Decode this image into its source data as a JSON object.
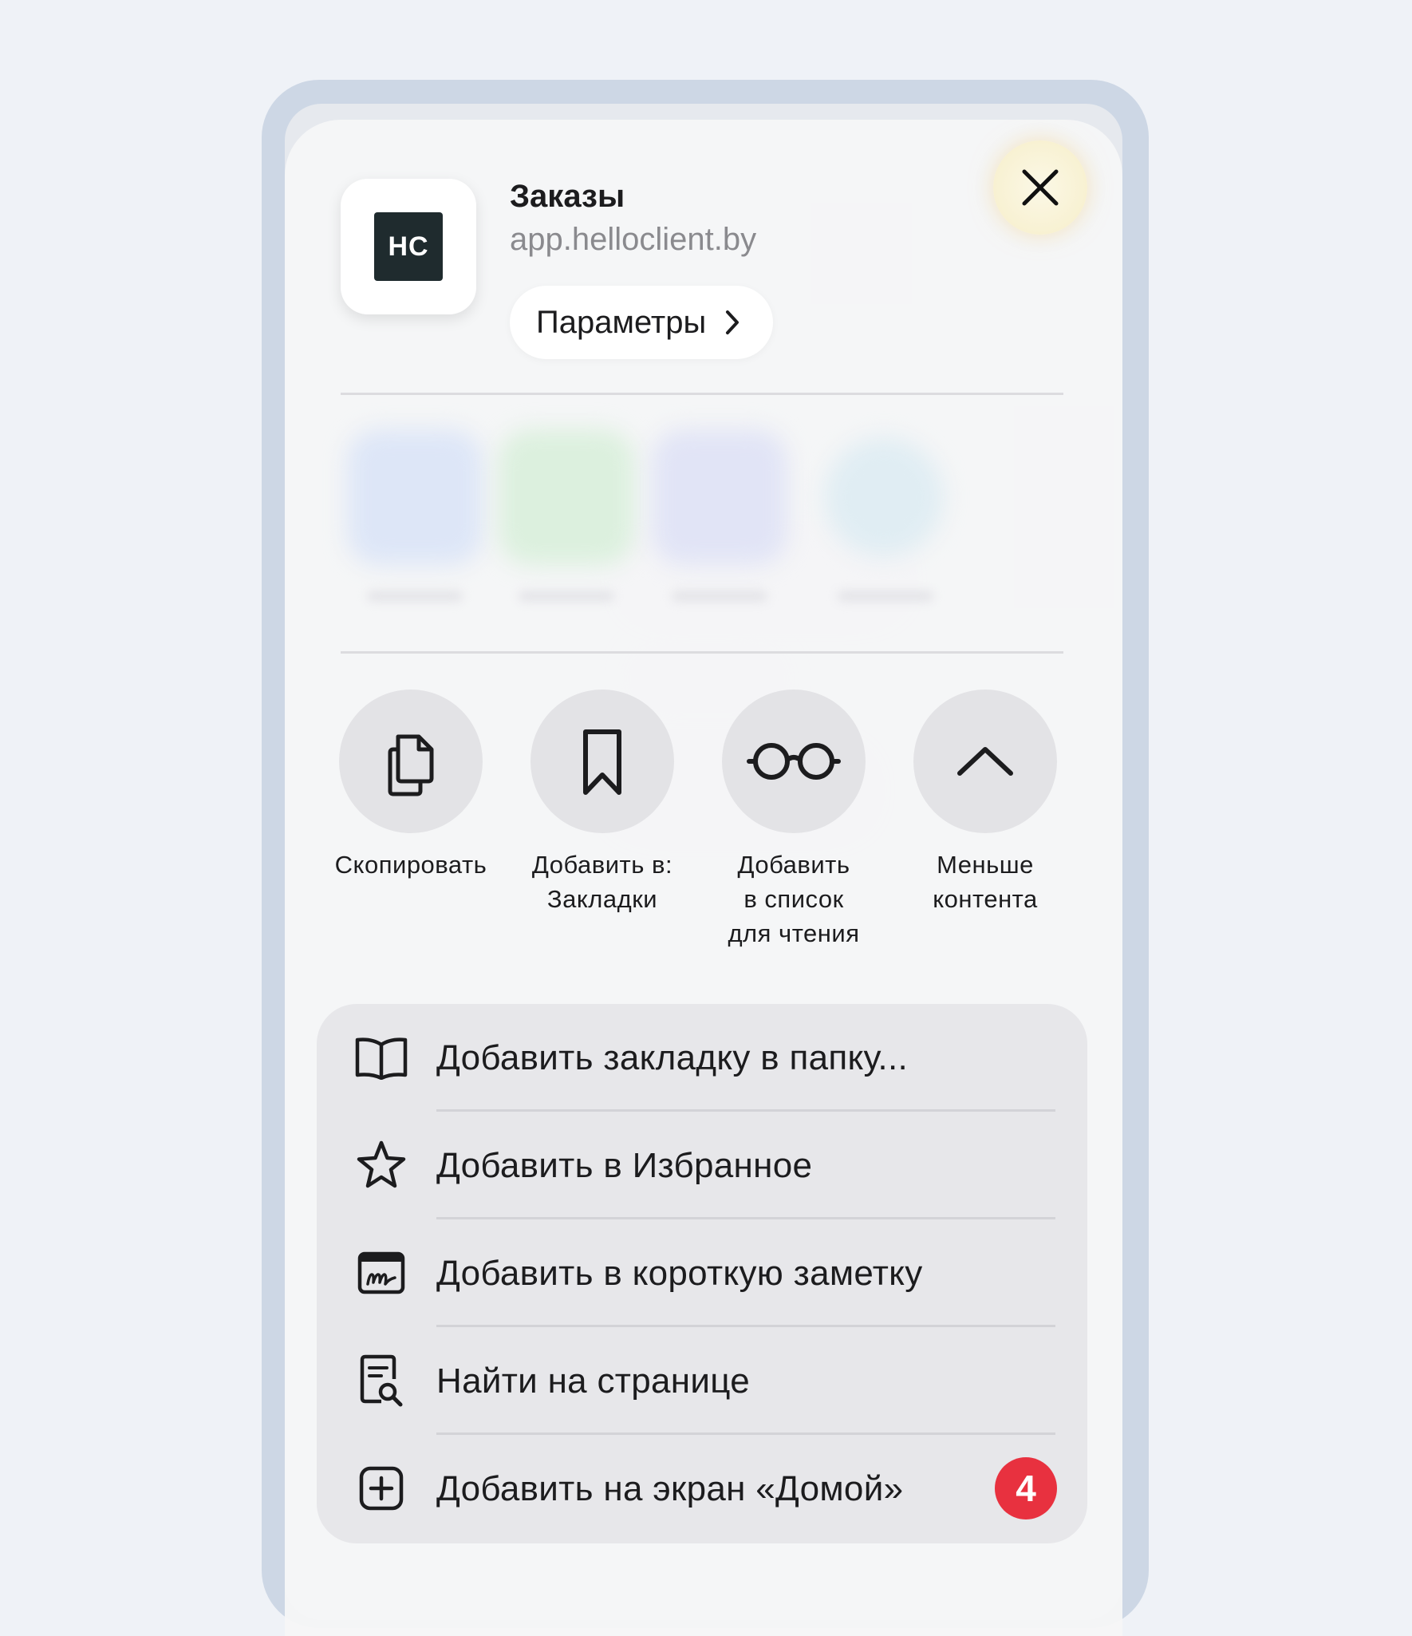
{
  "header": {
    "app_logo_text": "HC",
    "title": "Заказы",
    "url": "app.helloclient.by",
    "params_label": "Параметры"
  },
  "actions": [
    {
      "label": "Скопировать",
      "icon": "copy-icon"
    },
    {
      "label": "Добавить в:\nЗакладки",
      "icon": "bookmark-icon"
    },
    {
      "label": "Добавить\nв список\nдля чтения",
      "icon": "reading-list-icon"
    },
    {
      "label": "Меньше\nконтента",
      "icon": "chevron-up-icon"
    }
  ],
  "menu": {
    "items": [
      {
        "label": "Добавить закладку в папку...",
        "icon": "book-icon"
      },
      {
        "label": "Добавить в Избранное",
        "icon": "star-icon"
      },
      {
        "label": "Добавить в короткую заметку",
        "icon": "quick-note-icon"
      },
      {
        "label": "Найти на странице",
        "icon": "find-on-page-icon"
      },
      {
        "label": "Добавить на экран «Домой»",
        "icon": "add-square-icon"
      }
    ],
    "step_badge": "4"
  },
  "colors": {
    "badge": "#e8313f",
    "close_glow": "#f8f1d2",
    "sheet_bg": "#f6f6f7",
    "menu_bg": "#e7e7ea"
  }
}
